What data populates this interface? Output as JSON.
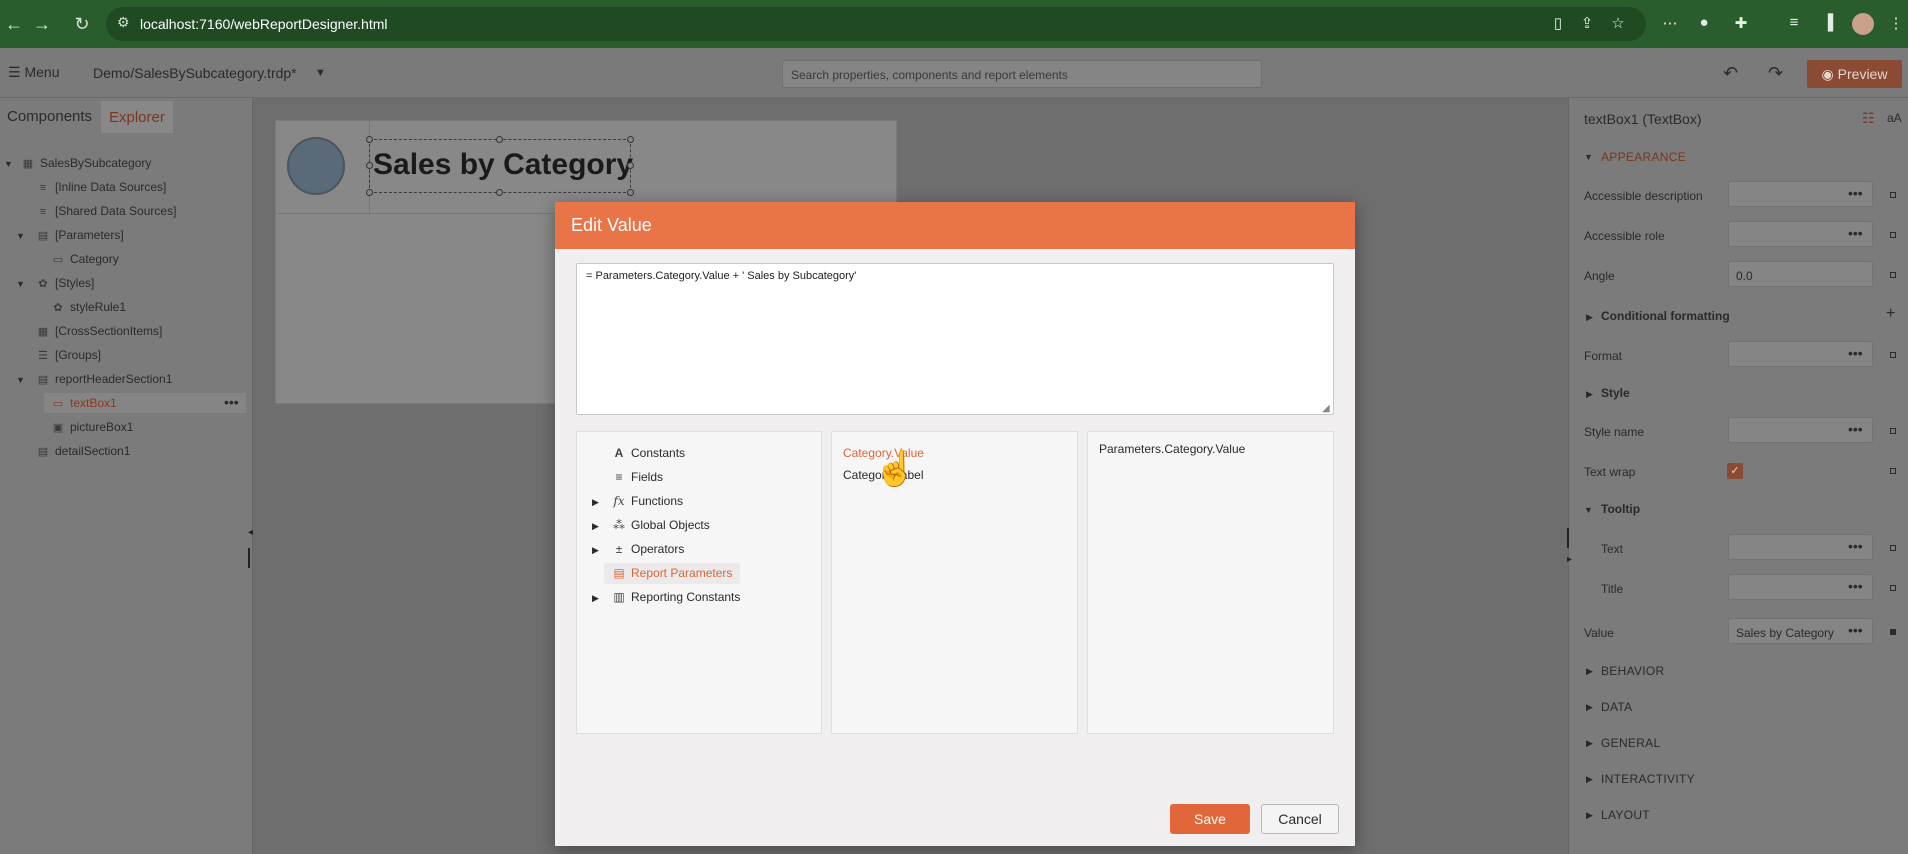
{
  "browser": {
    "url": "localhost:7160/webReportDesigner.html"
  },
  "toolbar": {
    "menu_label": "Menu",
    "file_name": "Demo/SalesBySubcategory.trdp*",
    "search_placeholder": "Search properties, components and report elements",
    "preview_label": "Preview"
  },
  "left_panel": {
    "tabs": [
      "Components",
      "Explorer"
    ],
    "active_tab": "Explorer",
    "tree": [
      {
        "label": "SalesBySubcategory",
        "icon": "report-icon"
      },
      {
        "label": "[Inline Data Sources]",
        "icon": "database-icon"
      },
      {
        "label": "[Shared Data Sources]",
        "icon": "database-icon"
      },
      {
        "label": "[Parameters]",
        "icon": "parameters-icon"
      },
      {
        "label": "Category",
        "icon": "parameter-icon"
      },
      {
        "label": "[Styles]",
        "icon": "styles-icon"
      },
      {
        "label": "styleRule1",
        "icon": "style-rule-icon"
      },
      {
        "label": "[CrossSectionItems]",
        "icon": "grid-icon"
      },
      {
        "label": "[Groups]",
        "icon": "groups-icon"
      },
      {
        "label": "reportHeaderSection1",
        "icon": "section-icon"
      },
      {
        "label": "textBox1",
        "icon": "textbox-icon"
      },
      {
        "label": "pictureBox1",
        "icon": "picture-icon"
      },
      {
        "label": "detailSection1",
        "icon": "section-icon"
      }
    ]
  },
  "design": {
    "report_title": "Sales by Category"
  },
  "properties": {
    "title": "textBox1 (TextBox)",
    "appearance_label": "APPEARANCE",
    "accessible_description": "Accessible description",
    "accessible_role": "Accessible role",
    "angle_label": "Angle",
    "angle_value": "0.0",
    "conditional_formatting": "Conditional formatting",
    "format_label": "Format",
    "style_label": "Style",
    "style_name": "Style name",
    "text_wrap": "Text wrap",
    "tooltip_label": "Tooltip",
    "tooltip_text": "Text",
    "tooltip_title": "Title",
    "value_label": "Value",
    "value_value": "Sales by Category",
    "sections": [
      "BEHAVIOR",
      "DATA",
      "GENERAL",
      "INTERACTIVITY",
      "LAYOUT"
    ]
  },
  "modal": {
    "title": "Edit Value",
    "expression": "= Parameters.Category.Value + ' Sales by Subcategory'",
    "categories": [
      "Constants",
      "Fields",
      "Functions",
      "Global Objects",
      "Operators",
      "Report Parameters",
      "Reporting Constants"
    ],
    "selected_category": "Report Parameters",
    "items": [
      "Category.Value",
      "Category.Label"
    ],
    "hovered_item": "Category.Value",
    "item_detail": "Parameters.Category.Value",
    "save_label": "Save",
    "cancel_label": "Cancel"
  },
  "colors": {
    "accent": "#e87447",
    "browser_chrome": "#2a5d2e"
  }
}
